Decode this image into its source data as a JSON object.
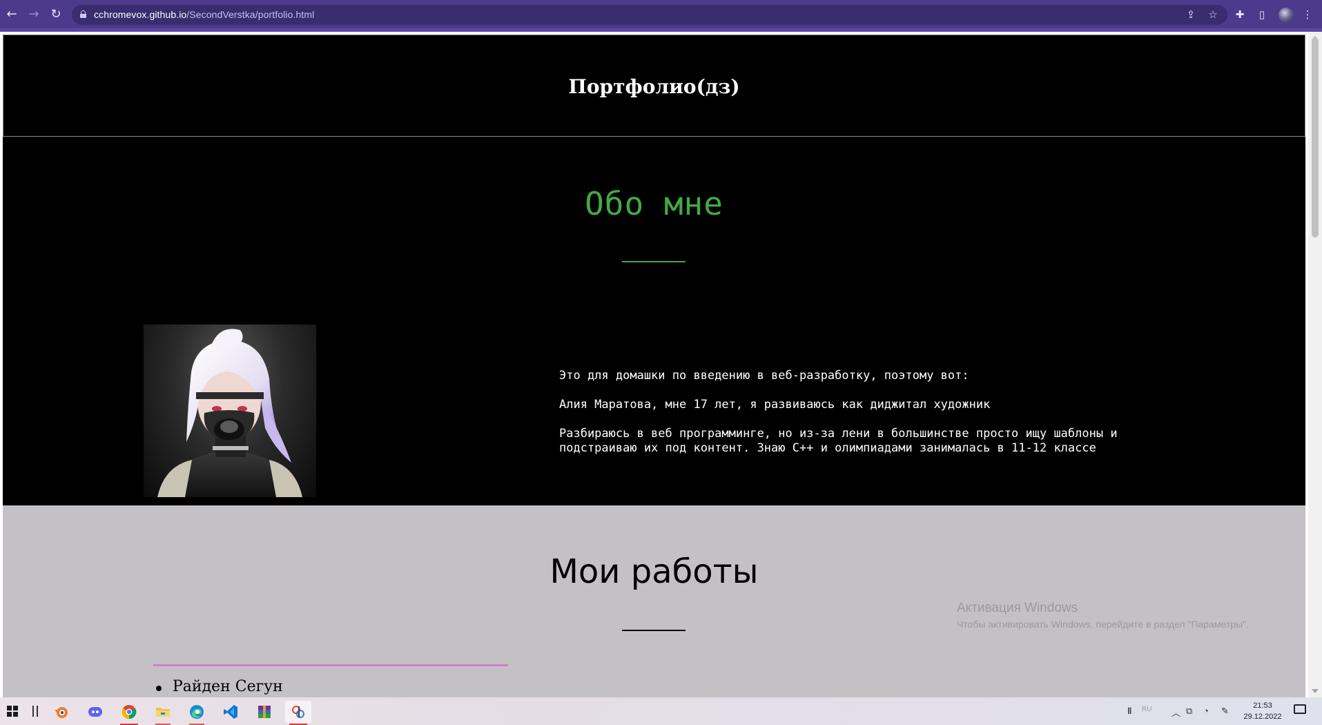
{
  "browser": {
    "url_host": "cchromevox.github.io",
    "url_path": "/SecondVerstka/portfolio.html",
    "back_icon": "←",
    "forward_icon": "→",
    "reload_icon": "↻",
    "share_icon": "⇪",
    "star_icon": "☆",
    "extensions_icon": "✚",
    "sidepanel_icon": "▯",
    "menu_icon": "⋮"
  },
  "page": {
    "header_title": "Портфолио(дз)",
    "about": {
      "heading": "Обо мне",
      "paragraphs": [
        "Это для домашки по введению в веб-разработку, поэтому вот:",
        "Алия Маратова, мне 17 лет, я развиваюсь как диджитал художник",
        "Разбираюсь в веб программинге, но из-за лени в большинстве просто ищу шаблоны и подстраиваю их под контент. Знаю С++ и олимпиадами занималась в 11-12 классе"
      ]
    },
    "works": {
      "heading": "Мои работы",
      "items": [
        "Райден Сегун"
      ]
    },
    "colors": {
      "accent_green": "#45a846",
      "header_bg": "#000000",
      "works_bg": "#c4c1c6"
    }
  },
  "watermark": {
    "title": "Активация Windows",
    "subtitle": "Чтобы активировать Windows, перейдите в раздел \"Параметры\"."
  },
  "taskbar": {
    "apps": [
      "blender",
      "discord",
      "chrome",
      "file-explorer",
      "edge",
      "vscode",
      "winrar",
      "paint"
    ],
    "lang": "RU",
    "time": "21:53",
    "date": "29.12.2022"
  }
}
